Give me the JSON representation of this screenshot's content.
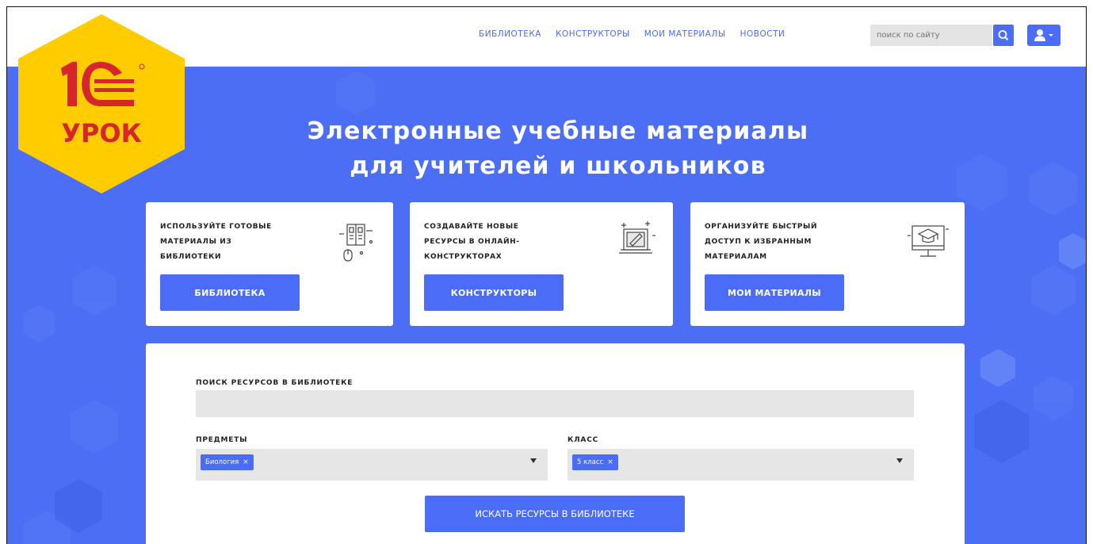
{
  "header": {
    "nav": [
      "БИБЛИОТЕКА",
      "КОНСТРУКТОРЫ",
      "МОИ МАТЕРИАЛЫ",
      "НОВОСТИ"
    ],
    "search_placeholder": "поиск по сайту"
  },
  "logo": {
    "brand": "1С",
    "text": "УРОК"
  },
  "hero": {
    "title_line1": "Электронные учебные материалы",
    "title_line2": "для учителей и школьников"
  },
  "cards": [
    {
      "text": "ИСПОЛЬЗУЙТЕ ГОТОВЫЕ\nМАТЕРИАЛЫ ИЗ\nБИБЛИОТЕКИ",
      "button": "БИБЛИОТЕКА",
      "icon": "library-icon"
    },
    {
      "text": "СОЗДАВАЙТЕ НОВЫЕ\nРЕСУРСЫ В ОНЛАЙН-\nКОНСТРУКТОРАХ",
      "button": "КОНСТРУКТОРЫ",
      "icon": "constructor-icon"
    },
    {
      "text": "ОРГАНИЗУЙТЕ БЫСТРЫЙ\nДОСТУП К ИЗБРАННЫМ\nМАТЕРИАЛАМ",
      "button": "МОИ МАТЕРИАЛЫ",
      "icon": "graduation-monitor-icon"
    }
  ],
  "search": {
    "label": "ПОИСК РЕСУРСОВ В БИБЛИОТЕКЕ",
    "query": "",
    "subjects_label": "ПРЕДМЕТЫ",
    "subjects_selected": "Биология",
    "class_label": "КЛАСС",
    "class_selected": "5 класс",
    "submit": "ИСКАТЬ РЕСУРСЫ В БИБЛИОТЕКЕ"
  },
  "colors": {
    "accent": "#4a6cf7",
    "hero_bg": "#4b6ef5",
    "logo_yellow": "#ffcc00",
    "logo_red": "#d6262b"
  }
}
